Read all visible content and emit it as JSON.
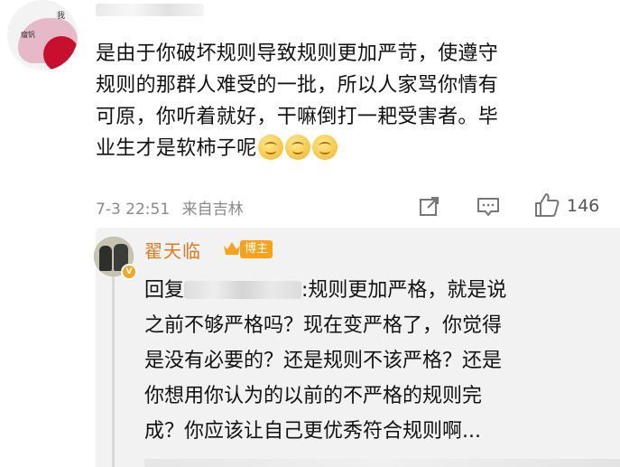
{
  "comment": {
    "avatar": {
      "text_top": "我",
      "text_left": "瘤钒"
    },
    "text_lines": [
      "是由于你破坏规则导致规则更加严苛，使遵守",
      "规则的那群人难受的一批，所以人家骂你情有",
      "可原，你听着就好，干嘛倒打一耙受害者。毕",
      "业生才是软柿子呢"
    ],
    "emoji_count": 3,
    "emoji_name": "doge-emoji",
    "time": "7-3 22:51",
    "source": "来自吉林",
    "like_count": "146"
  },
  "reply": {
    "author": "翟天临",
    "badge": "博主",
    "vip_badge": "V",
    "prefix": "回复",
    "body_first": ":规则更加严格，就是说",
    "body_lines": [
      "之前不够严格吗？现在变严格了，你觉得",
      "是没有必要的？还是规则不该严格？还是",
      "你想用你认为的以前的不严格的规则完",
      "成？你应该让自己更优秀符合规则啊..."
    ]
  },
  "colors": {
    "author_orange": "#e07a1f",
    "badge_orange": "#f6a21a",
    "meta_gray": "#8a8a8a",
    "reply_bg": "#f2f2f2"
  },
  "icons": [
    "share-icon",
    "comment-icon",
    "like-icon",
    "crown-icon"
  ]
}
